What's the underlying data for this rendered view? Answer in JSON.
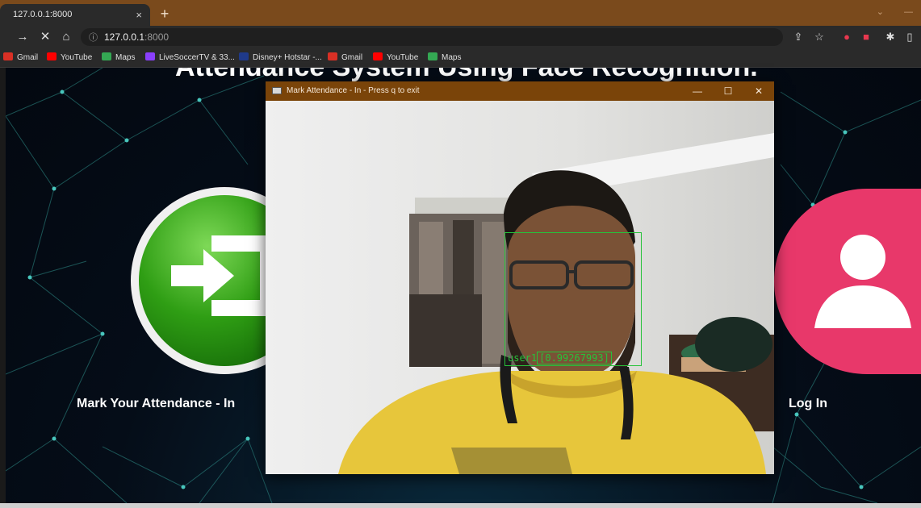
{
  "browser": {
    "tab_title": "127.0.0.1:8000",
    "tab_close": "×",
    "new_tab": "+",
    "url_host": "127.0.0.1",
    "url_port": ":8000",
    "bookmarks": [
      {
        "label": "Gmail",
        "color": "#d93025"
      },
      {
        "label": "YouTube",
        "color": "#ff0000"
      },
      {
        "label": "Maps",
        "color": "#34a853"
      },
      {
        "label": "LiveSoccerTV & 33...",
        "color": "#8a3ffc"
      },
      {
        "label": "Disney+ Hotstar -...",
        "color": "#1f3a8a"
      },
      {
        "label": "Gmail",
        "color": "#d93025"
      },
      {
        "label": "YouTube",
        "color": "#ff0000"
      },
      {
        "label": "Maps",
        "color": "#34a853"
      }
    ]
  },
  "page": {
    "title": "Attendance System Using Face Recognition.",
    "mark_in_label": "Mark Your Attendance - In",
    "login_label": "Log In",
    "accent_green": "#2f9e14",
    "accent_pink": "#e8386a"
  },
  "camera_window": {
    "title": "Mark Attendance - In - Press q to exit",
    "minimize": "—",
    "maximize": "☐",
    "close": "✕",
    "detection_name": "user1",
    "detection_score": "[0.99267993]",
    "box_color": "#27c23a"
  }
}
